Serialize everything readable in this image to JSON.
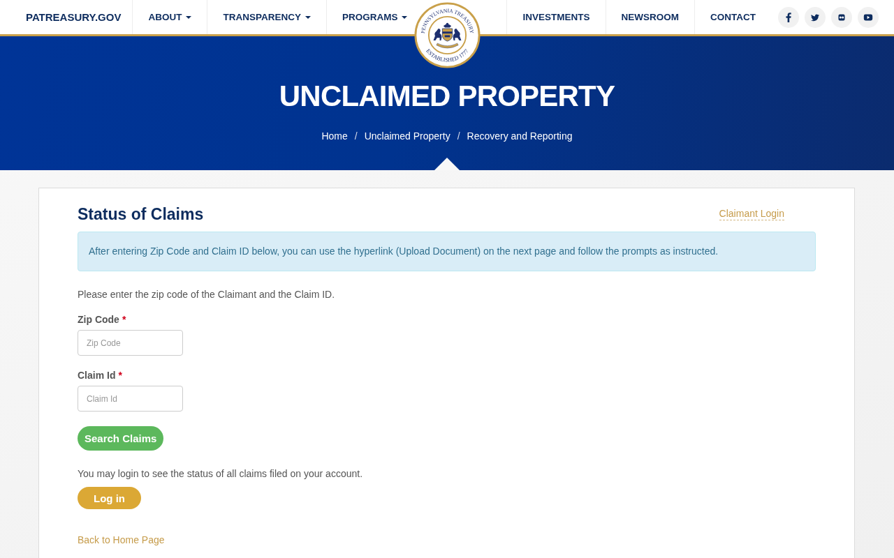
{
  "header": {
    "brand": "PATREASURY.GOV",
    "nav_left": [
      {
        "label": "ABOUT",
        "has_dropdown": true
      },
      {
        "label": "TRANSPARENCY",
        "has_dropdown": true
      },
      {
        "label": "PROGRAMS",
        "has_dropdown": true
      }
    ],
    "seal": {
      "top_text": "PENNSYLVANIA TREASURY",
      "bottom_text": "ESTABLISHED 1777"
    },
    "nav_right": [
      {
        "label": "INVESTMENTS",
        "has_dropdown": false
      },
      {
        "label": "NEWSROOM",
        "has_dropdown": false
      },
      {
        "label": "CONTACT",
        "has_dropdown": false
      }
    ],
    "social_links": [
      {
        "kind": "facebook"
      },
      {
        "kind": "twitter"
      },
      {
        "kind": "flickr"
      },
      {
        "kind": "youtube"
      }
    ]
  },
  "hero": {
    "title": "UNCLAIMED PROPERTY",
    "breadcrumb": [
      {
        "label": "Home"
      },
      {
        "separator": "/",
        "label": "Unclaimed Property"
      },
      {
        "separator": "/",
        "label": "Recovery and Reporting"
      }
    ]
  },
  "card": {
    "title": "Status of Claims",
    "claimant_login_link": "Claimant Login",
    "info_alert": "After entering Zip Code and Claim ID below, you can use the hyperlink (Upload Document) on the next page and follow the prompts as instructed.",
    "instructions": "Please enter the zip code of the Claimant and the Claim ID.",
    "fields": [
      {
        "label": "Zip Code",
        "required_mark": "*",
        "placeholder": "Zip Code"
      },
      {
        "label": "Claim Id",
        "required_mark": "*",
        "placeholder": "Claim Id"
      }
    ],
    "search_button": "Search Claims",
    "login_prompt": "You may login to see the status of all claims filed on your account.",
    "login_button": "Log in",
    "back_link": "Back to Home Page"
  }
}
